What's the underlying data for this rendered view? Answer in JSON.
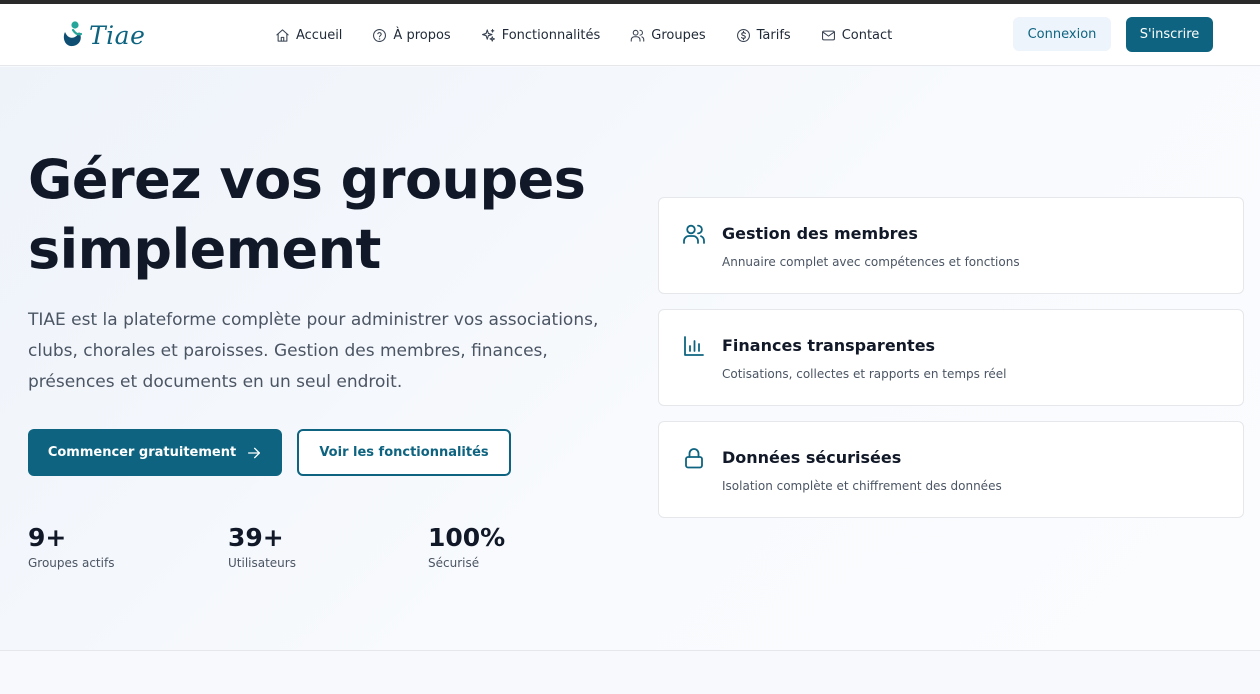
{
  "brand": {
    "name": "Tiae"
  },
  "nav": {
    "items": [
      {
        "label": "Accueil",
        "icon": "home-icon"
      },
      {
        "label": "À propos",
        "icon": "help-circle-icon"
      },
      {
        "label": "Fonctionnalités",
        "icon": "sparkles-icon"
      },
      {
        "label": "Groupes",
        "icon": "users-icon"
      },
      {
        "label": "Tarifs",
        "icon": "dollar-circle-icon"
      },
      {
        "label": "Contact",
        "icon": "mail-icon"
      }
    ],
    "login_label": "Connexion",
    "signup_label": "S'inscrire"
  },
  "hero": {
    "title": "Gérez vos groupes simplement",
    "description": "TIAE est la plateforme complète pour administrer vos associations, clubs, chorales et paroisses. Gestion des membres, finances, présences et documents en un seul endroit.",
    "primary_cta": "Commencer gratuitement",
    "secondary_cta": "Voir les fonctionnalités",
    "stats": [
      {
        "value": "9+",
        "label": "Groupes actifs"
      },
      {
        "value": "39+",
        "label": "Utilisateurs"
      },
      {
        "value": "100%",
        "label": "Sécurisé"
      }
    ]
  },
  "features": [
    {
      "title": "Gestion des membres",
      "description": "Annuaire complet avec compétences et fonctions",
      "icon": "users-icon"
    },
    {
      "title": "Finances transparentes",
      "description": "Cotisations, collectes et rapports en temps réel",
      "icon": "bar-chart-icon"
    },
    {
      "title": "Données sécurisées",
      "description": "Isolation complète et chiffrement des données",
      "icon": "lock-icon"
    }
  ],
  "colors": {
    "primary": "#0e6480",
    "accent": "#26a69a",
    "text": "#111827",
    "muted": "#4b5563"
  }
}
